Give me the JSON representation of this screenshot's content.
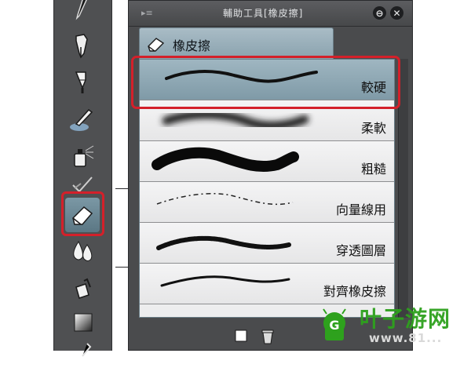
{
  "panel": {
    "title": "輔助工具[橡皮擦]",
    "grip_glyph": "▸≡",
    "minimize_glyph": "⊖",
    "close_glyph": "✕"
  },
  "tab": {
    "label": "橡皮擦",
    "icon": "eraser-icon"
  },
  "presets": [
    {
      "label": "較硬",
      "selected": true
    },
    {
      "label": "柔軟",
      "selected": false
    },
    {
      "label": "粗糙",
      "selected": false
    },
    {
      "label": "向量線用",
      "selected": false
    },
    {
      "label": "穿透圖層",
      "selected": false
    },
    {
      "label": "對齊橡皮擦",
      "selected": false
    }
  ],
  "tools": [
    {
      "icon": "pen-nib-icon"
    },
    {
      "icon": "fountain-pen-icon"
    },
    {
      "icon": "brush-icon"
    },
    {
      "icon": "airbrush-icon"
    },
    {
      "icon": "spray-icon"
    },
    {
      "icon": "blend-icon"
    },
    {
      "icon": "eraser-icon",
      "selected": true
    },
    {
      "icon": "water-drop-icon"
    },
    {
      "icon": "fill-bucket-icon"
    },
    {
      "icon": "gradient-icon"
    }
  ],
  "watermark": {
    "brand": "叶子游网",
    "url": "www.81..."
  },
  "colors": {
    "highlight": "#d4202a",
    "tab": "#99b0bb",
    "watermark": "#2ea11d"
  }
}
